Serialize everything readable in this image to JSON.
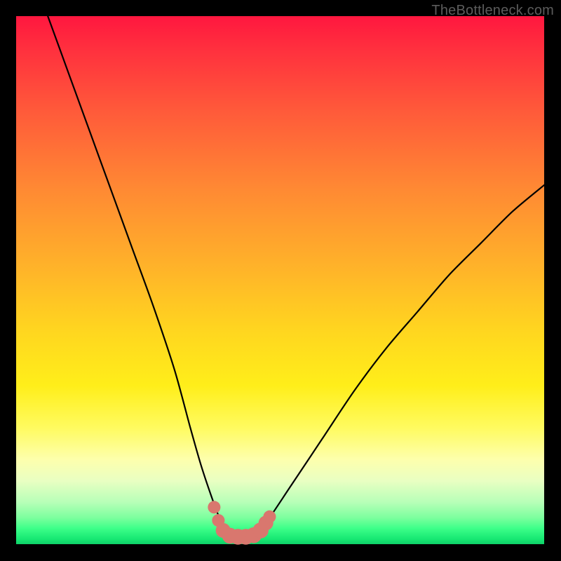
{
  "watermark": "TheBottleneck.com",
  "chart_data": {
    "type": "line",
    "title": "",
    "xlabel": "",
    "ylabel": "",
    "xlim": [
      0,
      100
    ],
    "ylim": [
      0,
      100
    ],
    "grid": false,
    "series": [
      {
        "name": "bottleneck-curve",
        "color": "#000000",
        "x": [
          6,
          10,
          14,
          18,
          22,
          26,
          30,
          33,
          35,
          37,
          38.5,
          40,
          41.5,
          43,
          44.5,
          46,
          48,
          52,
          58,
          64,
          70,
          76,
          82,
          88,
          94,
          100
        ],
        "y": [
          100,
          89,
          78,
          67,
          56,
          45,
          33,
          22,
          15,
          9,
          5,
          2.3,
          1.6,
          1.4,
          1.6,
          2.3,
          5,
          11,
          20,
          29,
          37,
          44,
          51,
          57,
          63,
          68
        ]
      }
    ],
    "markers": {
      "name": "trough-dots",
      "color": "#d9776e",
      "points": [
        {
          "x": 37.5,
          "y": 7.0,
          "r": 1.2
        },
        {
          "x": 38.3,
          "y": 4.5,
          "r": 1.2
        },
        {
          "x": 39.2,
          "y": 2.6,
          "r": 1.4
        },
        {
          "x": 40.5,
          "y": 1.6,
          "r": 1.5
        },
        {
          "x": 42.0,
          "y": 1.4,
          "r": 1.5
        },
        {
          "x": 43.5,
          "y": 1.4,
          "r": 1.5
        },
        {
          "x": 45.0,
          "y": 1.7,
          "r": 1.5
        },
        {
          "x": 46.3,
          "y": 2.6,
          "r": 1.5
        },
        {
          "x": 47.3,
          "y": 4.0,
          "r": 1.4
        },
        {
          "x": 48.0,
          "y": 5.2,
          "r": 1.2
        }
      ]
    }
  }
}
